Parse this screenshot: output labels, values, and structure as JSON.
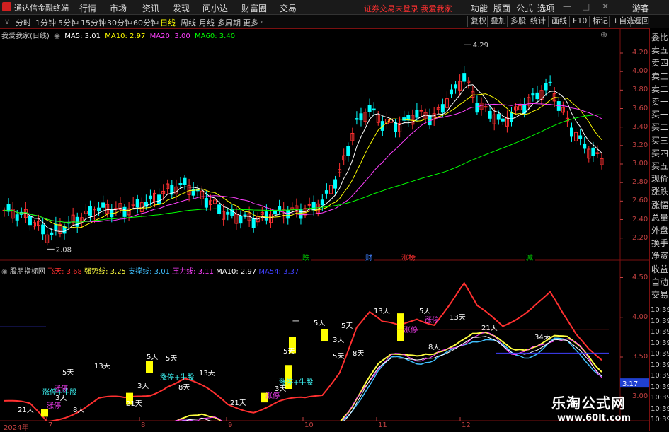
{
  "menu": {
    "app_name": "通达信金融终端",
    "items": [
      "行情",
      "市场",
      "资讯",
      "发现",
      "问小达",
      "财富圈",
      "交易"
    ],
    "warning": "证券交易未登录  我爱我家",
    "right_items": [
      "功能",
      "版面",
      "公式",
      "选项"
    ],
    "guest": "游客"
  },
  "toolbar": {
    "periods": [
      "分时",
      "1分钟",
      "5分钟",
      "15分钟",
      "30分钟",
      "60分钟",
      "日线",
      "周线",
      "月线",
      "多周期",
      "更多"
    ],
    "active": "日线",
    "right": [
      "复权",
      "叠加",
      "多股",
      "统计",
      "画线",
      "F10",
      "标记",
      "+自选",
      "返回"
    ]
  },
  "price_chart": {
    "stock_label": "我爱我家(日线)",
    "ma": [
      {
        "label": "MA5: 3.01",
        "color": "#ffffff"
      },
      {
        "label": "MA10: 2.97",
        "color": "#ffff00"
      },
      {
        "label": "MA20: 3.00",
        "color": "#ff40ff"
      },
      {
        "label": "MA60: 3.40",
        "color": "#00ff00"
      }
    ],
    "y_ticks": [
      "4.20",
      "4.00",
      "3.80",
      "3.60",
      "3.40",
      "3.20",
      "3.00",
      "2.80",
      "2.60",
      "2.40",
      "2.20"
    ],
    "y_range": [
      2.06,
      4.33
    ],
    "high_label": "4.29",
    "low_label": "2.08",
    "events": [
      {
        "text": "跌"
      },
      {
        "text": "财"
      },
      {
        "text": "涨榜"
      },
      {
        "text": "减"
      }
    ]
  },
  "indicator": {
    "name": "股朋指标网",
    "items": [
      {
        "label": "飞天: 3.68",
        "color": "#ff3030"
      },
      {
        "label": "强势线: 3.25",
        "color": "#ffff40"
      },
      {
        "label": "支撑线: 3.01",
        "color": "#40c0ff"
      },
      {
        "label": "压力线: 3.11",
        "color": "#ff40ff"
      },
      {
        "label": "MA10: 2.97",
        "color": "#ffffff"
      },
      {
        "label": "MA54: 3.37",
        "color": "#4040ff"
      }
    ],
    "y_ticks": [
      "4.50",
      "4.00",
      "3.50",
      "3.00"
    ],
    "current_value": "3.17",
    "annotations": [
      "21天",
      "涨停",
      "3天",
      "8天",
      "5天",
      "涨停",
      "13天",
      "21天",
      "3天",
      "5天",
      "5天",
      "8天",
      "13天",
      "21天",
      "涨停",
      "3天",
      "5天",
      "一",
      "5天",
      "5天",
      "5天",
      "8天",
      "涨停",
      "3天",
      "13天",
      "5天",
      "涨停",
      "13天",
      "8天",
      "21天",
      "34天"
    ],
    "pattern_text": [
      "涨停+牛股",
      "涨停+牛股",
      "涨停+牛股"
    ]
  },
  "side_panel": {
    "labels": [
      "委比",
      "卖五",
      "卖四",
      "卖三",
      "卖二",
      "卖一",
      "买一",
      "买二",
      "买三",
      "买四",
      "买五",
      "现价",
      "涨跌",
      "涨幅",
      "总量",
      "外盘",
      "换手",
      "净资",
      "收益",
      "自动",
      "交易"
    ],
    "times": [
      "10:39",
      "10:39",
      "10:39",
      "10:39",
      "10:39",
      "10:39",
      "10:39",
      "10:39",
      "10:39",
      "10:39",
      "10:39"
    ]
  },
  "x_axis": {
    "labels": [
      "2024年",
      "7",
      "8",
      "9",
      "10",
      "11",
      "12"
    ]
  },
  "watermark": {
    "line1": "乐淘公式网",
    "line2": "www.60lt.com"
  },
  "colors": {
    "up": "#ff3030",
    "down": "#00ffff",
    "bg": "#000000",
    "axis": "#c04040"
  }
}
